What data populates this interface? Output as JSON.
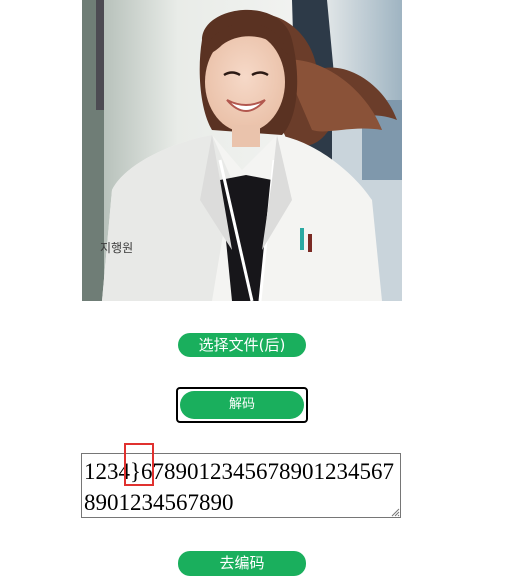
{
  "photo": {
    "alt": "",
    "badge_text": "지행원"
  },
  "buttons": {
    "select_file": "选择文件(后)",
    "decode": "解码",
    "encode": "去编码"
  },
  "textarea": {
    "value": "1234}67890123456789012345678901234567890"
  },
  "colors": {
    "button_green": "#1aaf5d",
    "marker_red": "#e0312f"
  }
}
